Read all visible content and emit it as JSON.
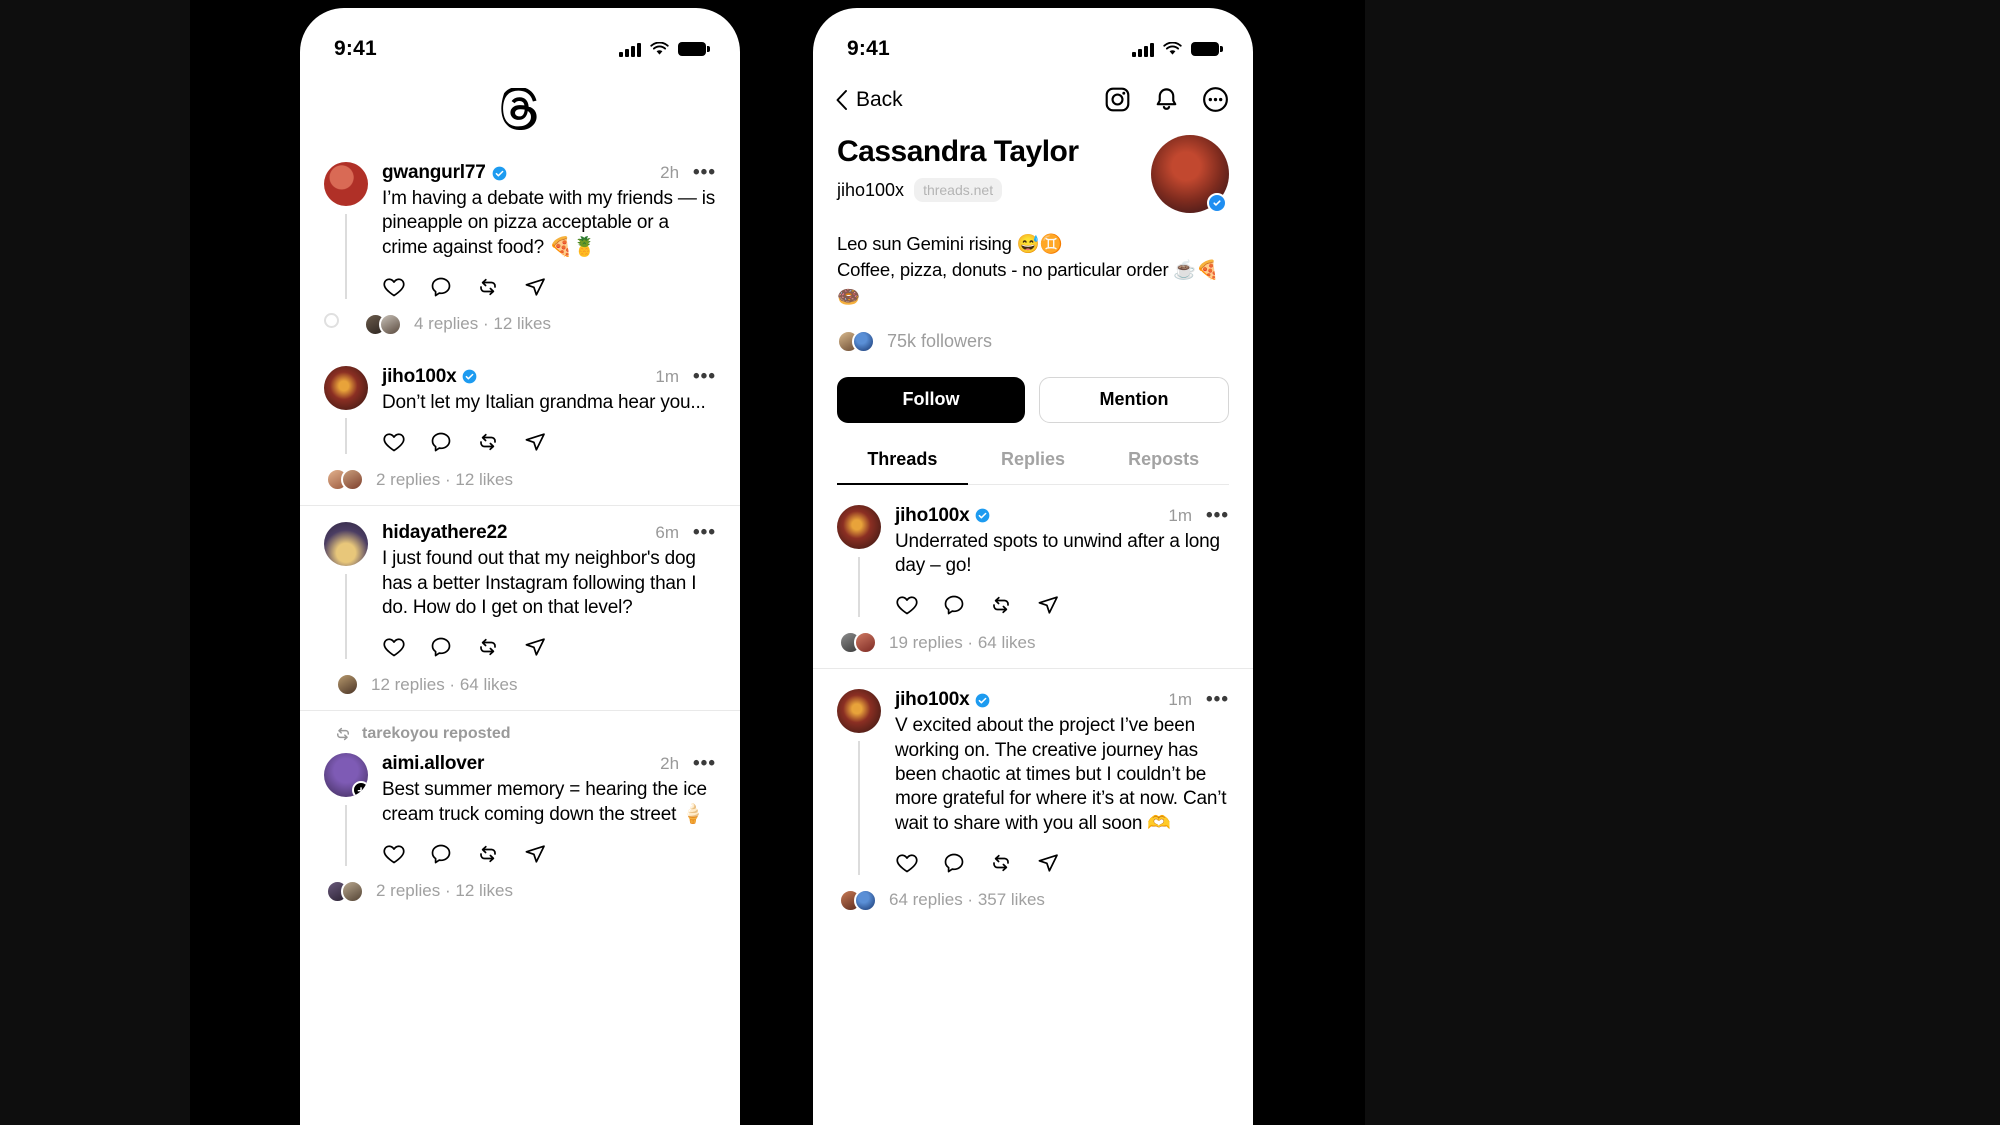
{
  "status_bar": {
    "time": "9:41",
    "signal_icon": "cellular-bars-icon",
    "wifi_icon": "wifi-icon",
    "battery_icon": "battery-full-icon"
  },
  "left_phone": {
    "app_logo": "threads-logo-icon",
    "feed": [
      {
        "username": "gwangurl77",
        "verified": true,
        "timestamp": "2h",
        "text": "I’m having a debate with my friends — is pineapple on pizza acceptable or a crime against food? 🍕🍍",
        "actions": [
          "like-icon",
          "comment-icon",
          "repost-icon",
          "share-icon"
        ],
        "footer": "4 replies · 12 likes",
        "has_thread_loop": true
      },
      {
        "username": "jiho100x",
        "verified": true,
        "timestamp": "1m",
        "text": "Don’t let my Italian grandma hear you...",
        "actions": [
          "like-icon",
          "comment-icon",
          "repost-icon",
          "share-icon"
        ],
        "footer": "2 replies · 12 likes",
        "has_thread_loop": false
      },
      {
        "username": "hidayathere22",
        "verified": false,
        "timestamp": "6m",
        "text": "I just found out that my neighbor's dog has a better Instagram following than I do. How do I get on that level?",
        "actions": [
          "like-icon",
          "comment-icon",
          "repost-icon",
          "share-icon"
        ],
        "footer": "12 replies · 64 likes",
        "has_thread_loop": false
      },
      {
        "repost_label": "tarekoyou reposted",
        "repost_icon": "repost-icon",
        "username": "aimi.allover",
        "verified": false,
        "timestamp": "2h",
        "text": "Best summer memory = hearing the ice cream truck coming down the street 🍦",
        "actions": [
          "like-icon",
          "comment-icon",
          "repost-icon",
          "share-icon"
        ],
        "footer": "2 replies · 12 likes",
        "has_thread_loop": false
      }
    ]
  },
  "right_phone": {
    "nav": {
      "back_label": "Back",
      "back_icon": "chevron-left-icon",
      "icons": [
        "instagram-icon",
        "bell-icon",
        "more-circle-icon"
      ]
    },
    "profile": {
      "name": "Cassandra Taylor",
      "handle": "jiho100x",
      "domain_chip": "threads.net",
      "verified_badge": "verified-badge-icon",
      "bio_line_1": "Leo sun Gemini rising 😅♊️",
      "bio_line_2": "Coffee, pizza, donuts - no particular order ☕🍕🍩",
      "followers": "75k followers",
      "follow_button": "Follow",
      "mention_button": "Mention"
    },
    "tabs": [
      {
        "label": "Threads",
        "active": true
      },
      {
        "label": "Replies",
        "active": false
      },
      {
        "label": "Reposts",
        "active": false
      }
    ],
    "posts": [
      {
        "username": "jiho100x",
        "verified": true,
        "timestamp": "1m",
        "text": "Underrated spots to unwind after a long day – go!",
        "actions": [
          "like-icon",
          "comment-icon",
          "repost-icon",
          "share-icon"
        ],
        "footer": "19 replies · 64 likes"
      },
      {
        "username": "jiho100x",
        "verified": true,
        "timestamp": "1m",
        "text": "V excited about the project I’ve been working on. The creative journey has been chaotic at times but I couldn’t be more grateful for where it’s at now. Can’t wait to share with you all soon 🫶",
        "actions": [
          "like-icon",
          "comment-icon",
          "repost-icon",
          "share-icon"
        ],
        "footer": "64 replies · 357 likes"
      }
    ]
  },
  "colors": {
    "verified_blue": "#1d9bf0",
    "accent_black": "#000000",
    "muted_gray": "#9d9d9d",
    "divider": "#e9e9e9"
  }
}
